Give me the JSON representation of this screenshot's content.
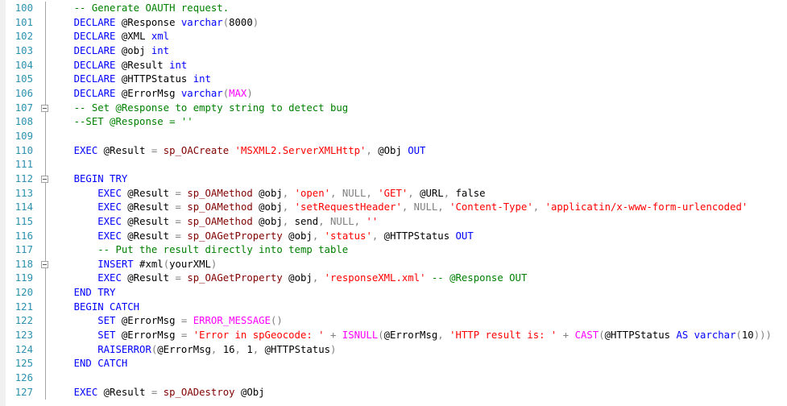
{
  "editor": {
    "colors": {
      "keyword": "#0000ff",
      "comment": "#008000",
      "string": "#ff0000",
      "function": "#ff00ff",
      "system_proc": "#800000",
      "operator": "#808080",
      "line_number": "#2b91af"
    },
    "lines": [
      {
        "num": "100",
        "fold": false,
        "tokens": [
          [
            "t",
            "    "
          ],
          [
            "c",
            "-- Generate OAUTH request."
          ]
        ]
      },
      {
        "num": "101",
        "fold": false,
        "tokens": [
          [
            "t",
            "    "
          ],
          [
            "k",
            "DECLARE"
          ],
          [
            "t",
            " @Response "
          ],
          [
            "k",
            "varchar"
          ],
          [
            "g",
            "("
          ],
          [
            "t",
            "8000"
          ],
          [
            "g",
            ")"
          ]
        ]
      },
      {
        "num": "102",
        "fold": false,
        "tokens": [
          [
            "t",
            "    "
          ],
          [
            "k",
            "DECLARE"
          ],
          [
            "t",
            " @XML "
          ],
          [
            "k",
            "xml"
          ]
        ]
      },
      {
        "num": "103",
        "fold": false,
        "tokens": [
          [
            "t",
            "    "
          ],
          [
            "k",
            "DECLARE"
          ],
          [
            "t",
            " @obj "
          ],
          [
            "k",
            "int"
          ]
        ]
      },
      {
        "num": "104",
        "fold": false,
        "tokens": [
          [
            "t",
            "    "
          ],
          [
            "k",
            "DECLARE"
          ],
          [
            "t",
            " @Result "
          ],
          [
            "k",
            "int"
          ]
        ]
      },
      {
        "num": "105",
        "fold": false,
        "tokens": [
          [
            "t",
            "    "
          ],
          [
            "k",
            "DECLARE"
          ],
          [
            "t",
            " @HTTPStatus "
          ],
          [
            "k",
            "int"
          ]
        ]
      },
      {
        "num": "106",
        "fold": false,
        "tokens": [
          [
            "t",
            "    "
          ],
          [
            "k",
            "DECLARE"
          ],
          [
            "t",
            " @ErrorMsg "
          ],
          [
            "k",
            "varchar"
          ],
          [
            "g",
            "("
          ],
          [
            "f",
            "MAX"
          ],
          [
            "g",
            ")"
          ]
        ]
      },
      {
        "num": "107",
        "fold": true,
        "tokens": [
          [
            "t",
            "    "
          ],
          [
            "c",
            "-- Set @Response to empty string to detect bug"
          ]
        ]
      },
      {
        "num": "108",
        "fold": false,
        "tokens": [
          [
            "t",
            "    "
          ],
          [
            "c",
            "--SET @Response = ''"
          ]
        ]
      },
      {
        "num": "109",
        "fold": false,
        "tokens": []
      },
      {
        "num": "110",
        "fold": false,
        "tokens": [
          [
            "t",
            "    "
          ],
          [
            "k",
            "EXEC"
          ],
          [
            "t",
            " @Result "
          ],
          [
            "g",
            "="
          ],
          [
            "t",
            " "
          ],
          [
            "p",
            "sp_OACreate"
          ],
          [
            "t",
            " "
          ],
          [
            "s",
            "'MSXML2.ServerXMLHttp'"
          ],
          [
            "g",
            ","
          ],
          [
            "t",
            " @Obj "
          ],
          [
            "k",
            "OUT"
          ]
        ]
      },
      {
        "num": "111",
        "fold": false,
        "tokens": []
      },
      {
        "num": "112",
        "fold": true,
        "tokens": [
          [
            "t",
            "    "
          ],
          [
            "k",
            "BEGIN TRY"
          ]
        ]
      },
      {
        "num": "113",
        "fold": false,
        "tokens": [
          [
            "t",
            "        "
          ],
          [
            "k",
            "EXEC"
          ],
          [
            "t",
            " @Result "
          ],
          [
            "g",
            "="
          ],
          [
            "t",
            " "
          ],
          [
            "p",
            "sp_OAMethod"
          ],
          [
            "t",
            " @obj"
          ],
          [
            "g",
            ","
          ],
          [
            "t",
            " "
          ],
          [
            "s",
            "'open'"
          ],
          [
            "g",
            ", NULL, "
          ],
          [
            "s",
            "'GET'"
          ],
          [
            "g",
            ","
          ],
          [
            "t",
            " @URL"
          ],
          [
            "g",
            ","
          ],
          [
            "t",
            " false"
          ]
        ]
      },
      {
        "num": "114",
        "fold": false,
        "tokens": [
          [
            "t",
            "        "
          ],
          [
            "k",
            "EXEC"
          ],
          [
            "t",
            " @Result "
          ],
          [
            "g",
            "="
          ],
          [
            "t",
            " "
          ],
          [
            "p",
            "sp_OAMethod"
          ],
          [
            "t",
            " @obj"
          ],
          [
            "g",
            ","
          ],
          [
            "t",
            " "
          ],
          [
            "s",
            "'setRequestHeader'"
          ],
          [
            "g",
            ", NULL, "
          ],
          [
            "s",
            "'Content-Type'"
          ],
          [
            "g",
            ", "
          ],
          [
            "s",
            "'applicatin/x-www-form-urlencoded'"
          ]
        ]
      },
      {
        "num": "115",
        "fold": false,
        "tokens": [
          [
            "t",
            "        "
          ],
          [
            "k",
            "EXEC"
          ],
          [
            "t",
            " @Result "
          ],
          [
            "g",
            "="
          ],
          [
            "t",
            " "
          ],
          [
            "p",
            "sp_OAMethod"
          ],
          [
            "t",
            " @obj"
          ],
          [
            "g",
            ","
          ],
          [
            "t",
            " send"
          ],
          [
            "g",
            ", NULL, "
          ],
          [
            "s",
            "''"
          ]
        ]
      },
      {
        "num": "116",
        "fold": false,
        "tokens": [
          [
            "t",
            "        "
          ],
          [
            "k",
            "EXEC"
          ],
          [
            "t",
            " @Result "
          ],
          [
            "g",
            "="
          ],
          [
            "t",
            " "
          ],
          [
            "p",
            "sp_OAGetProperty"
          ],
          [
            "t",
            " @obj"
          ],
          [
            "g",
            ","
          ],
          [
            "t",
            " "
          ],
          [
            "s",
            "'status'"
          ],
          [
            "g",
            ","
          ],
          [
            "t",
            " @HTTPStatus "
          ],
          [
            "k",
            "OUT"
          ]
        ]
      },
      {
        "num": "117",
        "fold": false,
        "tokens": [
          [
            "t",
            "        "
          ],
          [
            "c",
            "-- Put the result directly into temp table"
          ]
        ]
      },
      {
        "num": "118",
        "fold": true,
        "tokens": [
          [
            "t",
            "        "
          ],
          [
            "k",
            "INSERT"
          ],
          [
            "t",
            " #xml"
          ],
          [
            "g",
            "("
          ],
          [
            "t",
            "yourXML"
          ],
          [
            "g",
            ")"
          ]
        ]
      },
      {
        "num": "119",
        "fold": false,
        "tokens": [
          [
            "t",
            "        "
          ],
          [
            "k",
            "EXEC"
          ],
          [
            "t",
            " @Result "
          ],
          [
            "g",
            "="
          ],
          [
            "t",
            " "
          ],
          [
            "p",
            "sp_OAGetProperty"
          ],
          [
            "t",
            " @obj"
          ],
          [
            "g",
            ","
          ],
          [
            "t",
            " "
          ],
          [
            "s",
            "'responseXML.xml'"
          ],
          [
            "t",
            " "
          ],
          [
            "c",
            "-- @Response OUT"
          ]
        ]
      },
      {
        "num": "120",
        "fold": false,
        "tokens": [
          [
            "t",
            "    "
          ],
          [
            "k",
            "END TRY"
          ]
        ]
      },
      {
        "num": "121",
        "fold": false,
        "tokens": [
          [
            "t",
            "    "
          ],
          [
            "k",
            "BEGIN CATCH"
          ]
        ]
      },
      {
        "num": "122",
        "fold": false,
        "tokens": [
          [
            "t",
            "        "
          ],
          [
            "k",
            "SET"
          ],
          [
            "t",
            " @ErrorMsg "
          ],
          [
            "g",
            "="
          ],
          [
            "t",
            " "
          ],
          [
            "f",
            "ERROR_MESSAGE"
          ],
          [
            "g",
            "()"
          ]
        ]
      },
      {
        "num": "123",
        "fold": false,
        "tokens": [
          [
            "t",
            "        "
          ],
          [
            "k",
            "SET"
          ],
          [
            "t",
            " @ErrorMsg "
          ],
          [
            "g",
            "="
          ],
          [
            "t",
            " "
          ],
          [
            "s",
            "'Error in spGeocode: '"
          ],
          [
            "t",
            " "
          ],
          [
            "g",
            "+"
          ],
          [
            "t",
            " "
          ],
          [
            "f",
            "ISNULL"
          ],
          [
            "g",
            "("
          ],
          [
            "t",
            "@ErrorMsg"
          ],
          [
            "g",
            ","
          ],
          [
            "t",
            " "
          ],
          [
            "s",
            "'HTTP result is: '"
          ],
          [
            "t",
            " "
          ],
          [
            "g",
            "+"
          ],
          [
            "t",
            " "
          ],
          [
            "f",
            "CAST"
          ],
          [
            "g",
            "("
          ],
          [
            "t",
            "@HTTPStatus "
          ],
          [
            "k",
            "AS"
          ],
          [
            "t",
            " "
          ],
          [
            "k",
            "varchar"
          ],
          [
            "g",
            "("
          ],
          [
            "t",
            "10"
          ],
          [
            "g",
            ")))"
          ]
        ]
      },
      {
        "num": "124",
        "fold": false,
        "tokens": [
          [
            "t",
            "        "
          ],
          [
            "k",
            "RAISERROR"
          ],
          [
            "g",
            "("
          ],
          [
            "t",
            "@ErrorMsg"
          ],
          [
            "g",
            ","
          ],
          [
            "t",
            " 16"
          ],
          [
            "g",
            ","
          ],
          [
            "t",
            " 1"
          ],
          [
            "g",
            ","
          ],
          [
            "t",
            " @HTTPStatus"
          ],
          [
            "g",
            ")"
          ]
        ]
      },
      {
        "num": "125",
        "fold": false,
        "tokens": [
          [
            "t",
            "    "
          ],
          [
            "k",
            "END CATCH"
          ]
        ]
      },
      {
        "num": "126",
        "fold": false,
        "tokens": []
      },
      {
        "num": "127",
        "fold": false,
        "tokens": [
          [
            "t",
            "    "
          ],
          [
            "k",
            "EXEC"
          ],
          [
            "t",
            " @Result "
          ],
          [
            "g",
            "="
          ],
          [
            "t",
            " "
          ],
          [
            "p",
            "sp_OADestroy"
          ],
          [
            "t",
            " @Obj"
          ]
        ]
      }
    ]
  }
}
